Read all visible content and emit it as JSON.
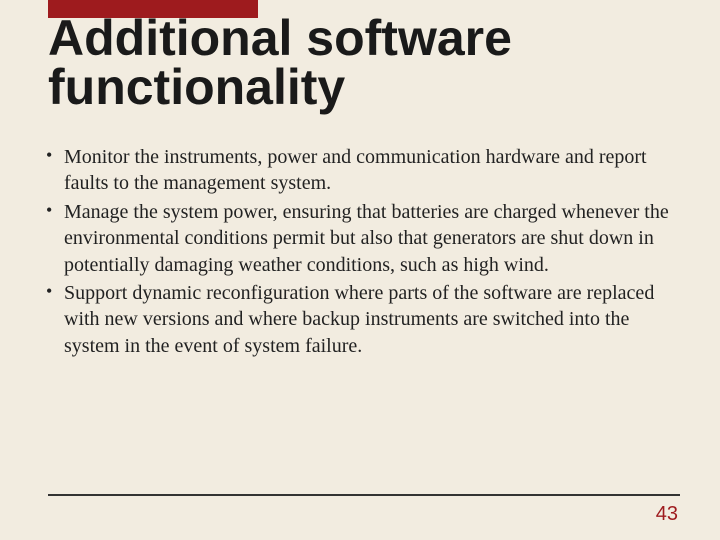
{
  "title_line1": "Additional software",
  "title_line2": "functionality",
  "bullets": [
    "Monitor the instruments, power and communication hardware and report faults to the management system.",
    "Manage the system power, ensuring that batteries are charged whenever the environmental conditions permit but also that generators are shut down in potentially damaging weather conditions, such as high wind.",
    "Support dynamic reconfiguration where parts of the software are replaced with new versions and where backup instruments are switched into the system in the event of system failure."
  ],
  "page_number": "43"
}
